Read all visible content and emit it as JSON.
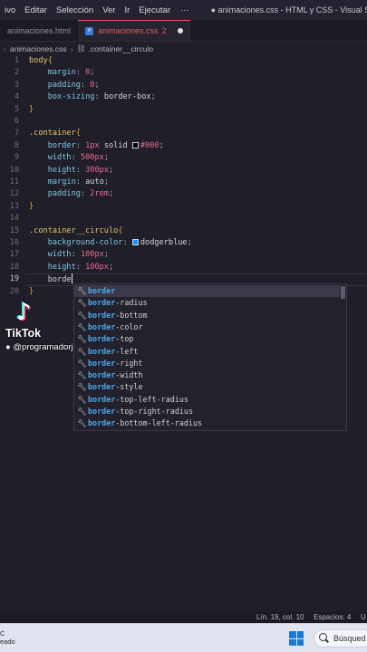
{
  "menubar": {
    "items": [
      "ivo",
      "Editar",
      "Selección",
      "Ver",
      "Ir",
      "Ejecutar",
      "···"
    ],
    "window_title": "● animaciones.css - HTML y CSS - Visual Studio"
  },
  "tabs": [
    {
      "label": "animaciones.html",
      "active": false
    },
    {
      "label": "animaciones.css",
      "badge": "2",
      "active": true
    }
  ],
  "breadcrumb": {
    "file": "animaciones.css",
    "symbol": ".container__circulo"
  },
  "editor": {
    "line_numbers": [
      "1",
      "2",
      "3",
      "4",
      "5",
      "6",
      "7",
      "8",
      "9",
      "10",
      "11",
      "12",
      "13",
      "14",
      "15",
      "16",
      "17",
      "18",
      "19",
      "20"
    ],
    "line_prefixes": [
      "",
      "    ",
      "    ",
      "    ",
      "",
      "",
      "",
      "    ",
      "    ",
      "    ",
      "    ",
      "    ",
      "",
      "",
      "",
      "    ",
      "    ",
      "    ",
      "    ",
      ""
    ],
    "lines": {
      "l1_sel": "body",
      "l1_brace": "{",
      "l2_prop": "margin",
      "l2_val": "0",
      "l3_prop": "padding",
      "l3_val": "0",
      "l4_prop": "box-sizing",
      "l4_val": "border-box",
      "l5_brace": "}",
      "l7_sel": ".container",
      "l7_brace": "{",
      "l8_prop": "border",
      "l8_val1": "1px",
      "l8_val2": "solid",
      "l8_val3": "#000",
      "l9_prop": "width",
      "l9_val": "500px",
      "l10_prop": "height",
      "l10_val": "300px",
      "l11_prop": "margin",
      "l11_val": "auto",
      "l12_prop": "padding",
      "l12_val": "2rem",
      "l13_brace": "}",
      "l15_sel": ".container__circulo",
      "l15_brace": "{",
      "l16_prop": "background-color",
      "l16_val": "dodgerblue",
      "l17_prop": "width",
      "l17_val": "100px",
      "l18_prop": "height",
      "l18_val": "100px",
      "l19_typed": "borde",
      "l20_brace": "}"
    },
    "colors": {
      "swatch_black": "#000000",
      "swatch_dodgerblue": "#1e90ff"
    }
  },
  "suggestions": {
    "match_prefix": "border",
    "items": [
      {
        "match": "border",
        "rest": ""
      },
      {
        "match": "border",
        "rest": "-radius"
      },
      {
        "match": "border",
        "rest": "-bottom"
      },
      {
        "match": "border",
        "rest": "-color"
      },
      {
        "match": "border",
        "rest": "-top"
      },
      {
        "match": "border",
        "rest": "-left"
      },
      {
        "match": "border",
        "rest": "-right"
      },
      {
        "match": "border",
        "rest": "-width"
      },
      {
        "match": "border",
        "rest": "-style"
      },
      {
        "match": "border",
        "rest": "-top-left-radius"
      },
      {
        "match": "border",
        "rest": "-top-right-radius"
      },
      {
        "match": "border",
        "rest": "-bottom-left-radius"
      }
    ],
    "icon": "wrench-icon"
  },
  "watermark": {
    "brand": "TikTok",
    "user": "@programadorjs"
  },
  "statusbar": {
    "position": "Lín. 19, col. 10",
    "spaces": "Espacios: 4",
    "extra": "U"
  },
  "taskbar": {
    "left_line1": "C",
    "left_line2": "eado",
    "search_label": "Búsqued"
  }
}
